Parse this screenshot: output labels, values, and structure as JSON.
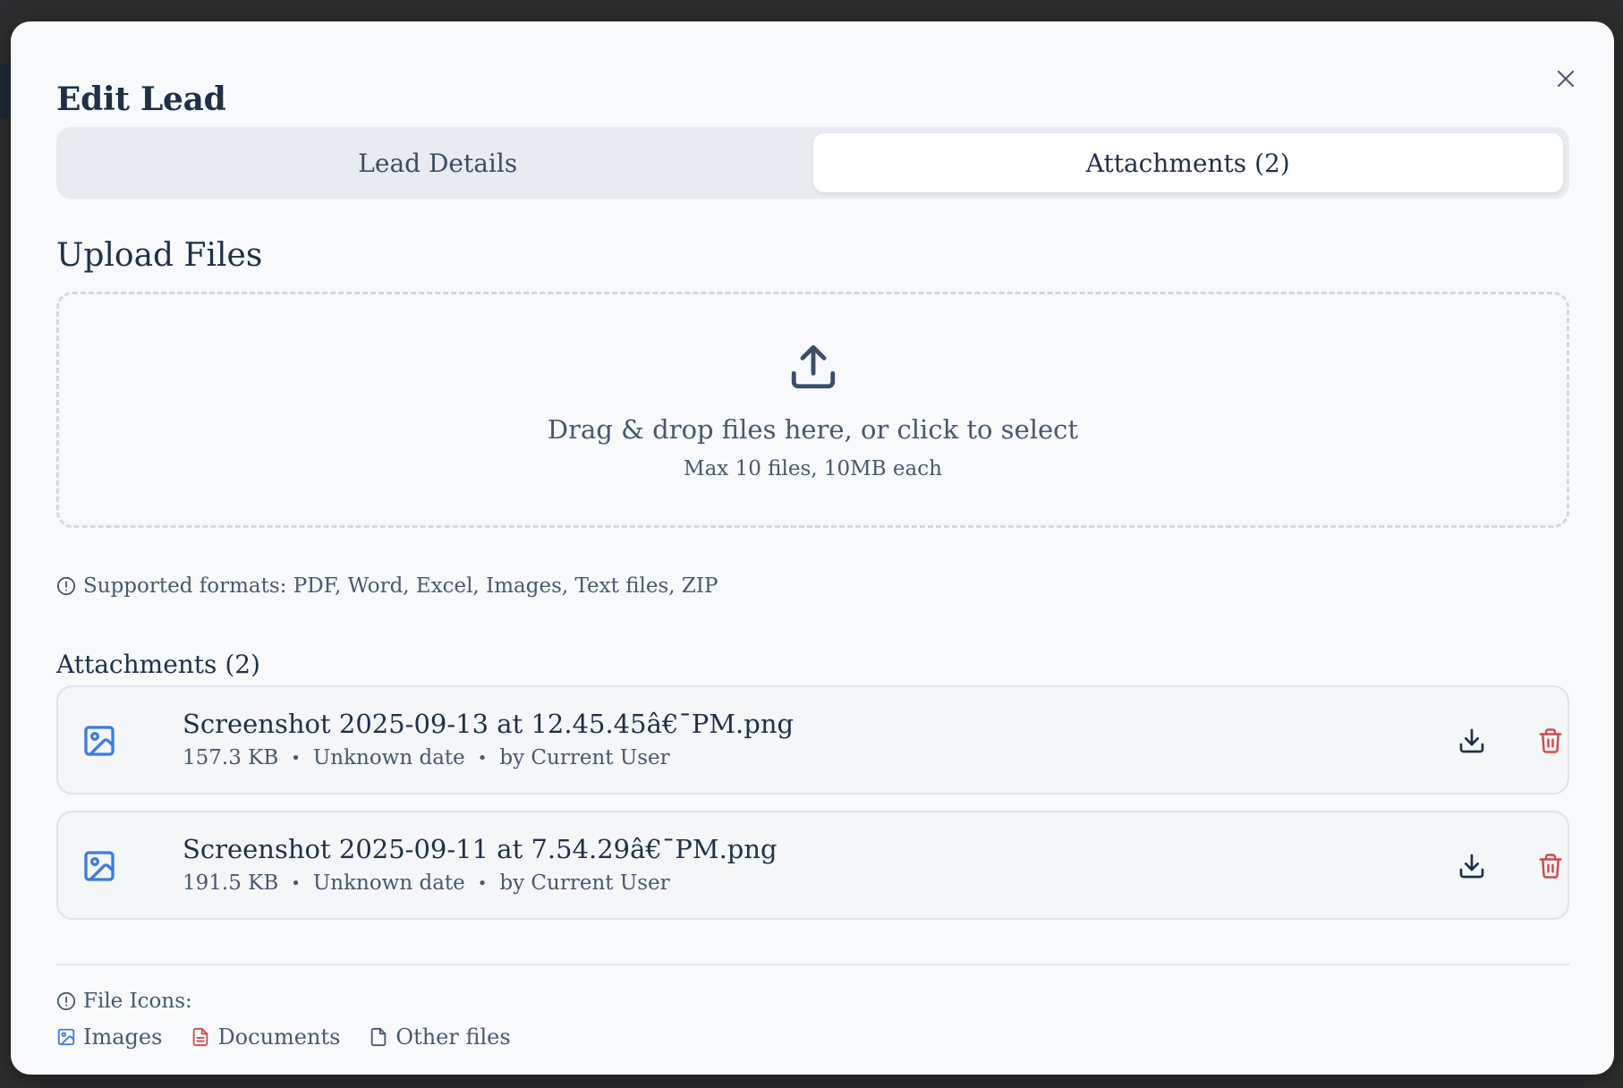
{
  "modal": {
    "title": "Edit Lead",
    "close_icon": "close-icon"
  },
  "tabs": [
    {
      "label": "Lead Details",
      "active": false
    },
    {
      "label": "Attachments (2)",
      "active": true
    }
  ],
  "upload": {
    "section_title": "Upload Files",
    "icon": "upload-icon",
    "instruction": "Drag & drop files here, or click to select",
    "limits": "Max 10 files, 10MB each",
    "formats": "Supported formats: PDF, Word, Excel, Images, Text files, ZIP"
  },
  "attachments": {
    "heading": "Attachments (2)",
    "files": [
      {
        "name": "Screenshot 2025-09-13 at 12.45.45â€¯PM.png",
        "size": "157.3 KB",
        "date": "Unknown date",
        "author": "by Current User",
        "icon": "image-file-icon"
      },
      {
        "name": "Screenshot 2025-09-11 at 7.54.29â€¯PM.png",
        "size": "191.5 KB",
        "date": "Unknown date",
        "author": "by Current User",
        "icon": "image-file-icon"
      }
    ],
    "separator": "•"
  },
  "legend": {
    "title": "File Icons:",
    "items": [
      {
        "label": "Images",
        "icon": "image-file-icon",
        "color": "#3d7be0"
      },
      {
        "label": "Documents",
        "icon": "document-file-icon",
        "color": "#d24b4b"
      },
      {
        "label": "Other files",
        "icon": "generic-file-icon",
        "color": "#47586e"
      }
    ]
  },
  "colors": {
    "accent_blue": "#3d7be0",
    "danger_red": "#d24b4b",
    "text_dark": "#1f3047",
    "text_muted": "#47586e"
  }
}
